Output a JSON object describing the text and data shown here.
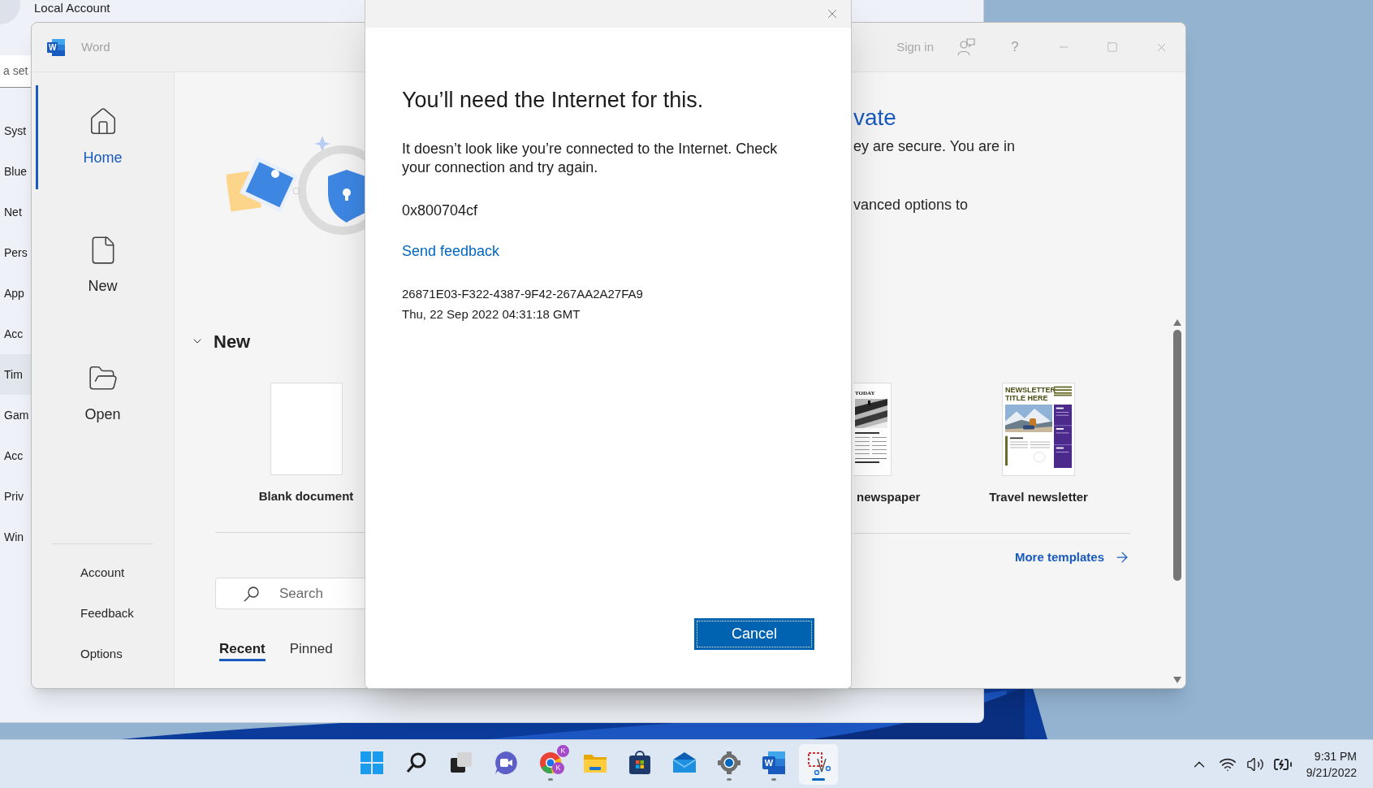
{
  "settings_window": {
    "title": "Local Account",
    "search": {
      "value": "a set"
    },
    "nav": [
      {
        "label": "Syst",
        "selected": false
      },
      {
        "label": "Blue",
        "selected": false
      },
      {
        "label": "Net",
        "selected": false
      },
      {
        "label": "Pers",
        "selected": false
      },
      {
        "label": "App",
        "selected": false
      },
      {
        "label": "Acc",
        "selected": false
      },
      {
        "label": "Tim",
        "selected": true
      },
      {
        "label": "Gam",
        "selected": false
      },
      {
        "label": "Acc",
        "selected": false
      },
      {
        "label": "Priv",
        "selected": false
      },
      {
        "label": "Win",
        "selected": false
      }
    ]
  },
  "word_window": {
    "logo_letter": "W",
    "app_name": "Word",
    "sign_in": "Sign in",
    "help": "?",
    "nav": [
      {
        "kind": "home",
        "label": "Home",
        "selected": true
      },
      {
        "kind": "new",
        "label": "New",
        "selected": false
      },
      {
        "kind": "open",
        "label": "Open",
        "selected": false
      }
    ],
    "nav_footer": [
      "Account",
      "Feedback",
      "Options"
    ],
    "banner": {
      "heading": "vate",
      "lines": [
        "ey are secure. You are in",
        "vanced options to"
      ]
    },
    "new_section": {
      "heading": "New",
      "expanded": true,
      "templates": [
        {
          "kind": "blank",
          "label": "Blank document"
        },
        {
          "kind": "newspaper",
          "label": "newspaper",
          "preview_title": "TODAY"
        },
        {
          "kind": "newsletter",
          "label": "Travel newsletter",
          "preview_title": "NEWSLETTER TITLE HERE"
        }
      ],
      "more_link": "More templates"
    },
    "search": {
      "placeholder": "Search"
    },
    "tabs": [
      {
        "label": "Recent",
        "selected": true
      },
      {
        "label": "Pinned",
        "selected": false
      }
    ]
  },
  "dialog": {
    "title": "You’ll need the Internet for this.",
    "message": "It doesn’t look like you’re connected to the Internet. Check your connection and try again.",
    "code": "0x800704cf",
    "feedback_link": "Send feedback",
    "correlation_id": "26871E03-F322-4387-9F42-267AA2A27FA9",
    "timestamp": "Thu, 22 Sep 2022 04:31:18 GMT",
    "button": "Cancel"
  },
  "taskbar": {
    "apps": [
      {
        "kind": "start",
        "running": false,
        "selected": false
      },
      {
        "kind": "search",
        "running": false,
        "selected": false
      },
      {
        "kind": "task_view",
        "running": false,
        "selected": false
      },
      {
        "kind": "chat",
        "running": false,
        "selected": false
      },
      {
        "kind": "browser",
        "running": true,
        "selected": false,
        "badges": [
          "K",
          "K"
        ]
      },
      {
        "kind": "files",
        "running": false,
        "selected": false
      },
      {
        "kind": "store",
        "running": false,
        "selected": false
      },
      {
        "kind": "mail",
        "running": false,
        "selected": false
      },
      {
        "kind": "settings",
        "running": true,
        "selected": false
      },
      {
        "kind": "word",
        "running": true,
        "selected": false,
        "letter": "W"
      },
      {
        "kind": "snipping",
        "running": true,
        "selected": true
      }
    ],
    "clock": {
      "time": "9:31 PM",
      "date": "9/21/2022"
    }
  }
}
